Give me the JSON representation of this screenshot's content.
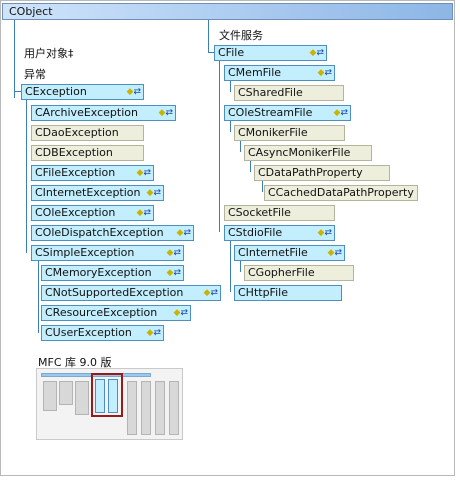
{
  "root": "CObject",
  "labels": {
    "user_objects": "用户对象‡",
    "exceptions": "异常",
    "file_services": "文件服务"
  },
  "exceptions": {
    "root": "CException",
    "children": [
      "CArchiveException",
      "CDaoException",
      "CDBException",
      "CFileException",
      "CInternetException",
      "COleException",
      "COleDispatchException",
      "CSimpleException"
    ],
    "simple_children": [
      "CMemoryException",
      "CNotSupportedException",
      "CResourceException",
      "CUserException"
    ]
  },
  "files": {
    "root": "CFile",
    "mem": "CMemFile",
    "shared": "CSharedFile",
    "olestream": "COleStreamFile",
    "moniker": "CMonikerFile",
    "asyncmoniker": "CAsyncMonikerFile",
    "datapath": "CDataPathProperty",
    "cacheddatapath": "CCachedDataPathProperty",
    "socket": "CSocketFile",
    "stdio": "CStdioFile",
    "internet": "CInternetFile",
    "gopher": "CGopherFile",
    "http": "CHttpFile"
  },
  "minimap": {
    "title": "MFC 库 9.0 版"
  },
  "colors": {
    "class_fill": "#c2eefe",
    "plain_fill": "#eeeedd",
    "root_bar": "#8db6e6",
    "highlight": "#9a1a1a"
  }
}
